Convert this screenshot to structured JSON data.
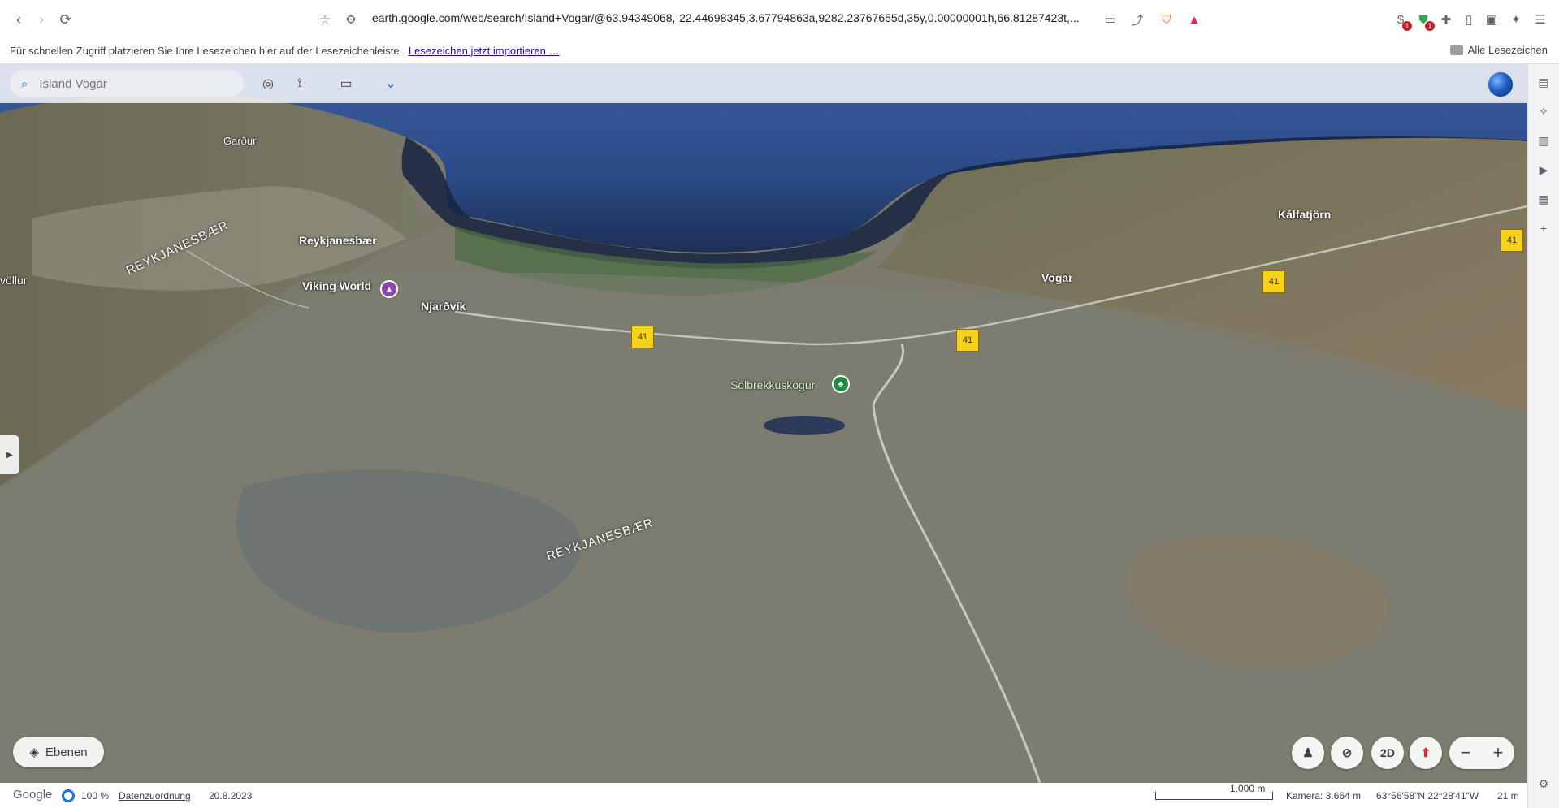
{
  "browser": {
    "url": "earth.google.com/web/search/Island+Vogar/@63.94349068,-22.44698345,3.67794863a,9282.23767655d,35y,0.00000001h,66.81287423t,...",
    "bookmark_hint": "Für schnellen Zugriff platzieren Sie Ihre Lesezeichen hier auf der Lesezeichenleiste.",
    "bookmark_import_link": "Lesezeichen jetzt importieren …",
    "all_bookmarks": "Alle Lesezeichen",
    "ext_badge_1": "1",
    "ext_badge_2": "1"
  },
  "earth": {
    "search_placeholder": "Island Vogar",
    "layers_label": "Ebenen",
    "mode_2d_label": "2D"
  },
  "map_labels": {
    "gardur": "Garður",
    "reykjanesbaer_town": "Reykjanesbær",
    "reykjanesbaer_region_1": "REYKJANESBÆR",
    "reykjanesbaer_region_2": "REYKJANESBÆR",
    "vollur": "völlur",
    "viking_world": "Viking World",
    "njardvik": "Njarðvík",
    "vogar": "Vogar",
    "kalfatjorn": "Kálfatjörn",
    "solbrekkuskogur": "Sólbrekkuskógur",
    "road_41_a": "41",
    "road_41_b": "41",
    "road_41_c": "41",
    "road_41_d": "41"
  },
  "status": {
    "brand": "Google",
    "percent": "100 %",
    "attribution": "Datenzuordnung",
    "date": "20.8.2023",
    "scale": "1.000 m",
    "camera": "Kamera: 3.664 m",
    "coords": "63°56'58\"N 22°28'41\"W",
    "elevation": "21 m"
  },
  "colors": {
    "ocean": "#2b4a86",
    "deep_ocean": "#1d2f55",
    "land": "#7b7864",
    "road_shield": "#f6d21b",
    "accent": "#1a73e8"
  }
}
